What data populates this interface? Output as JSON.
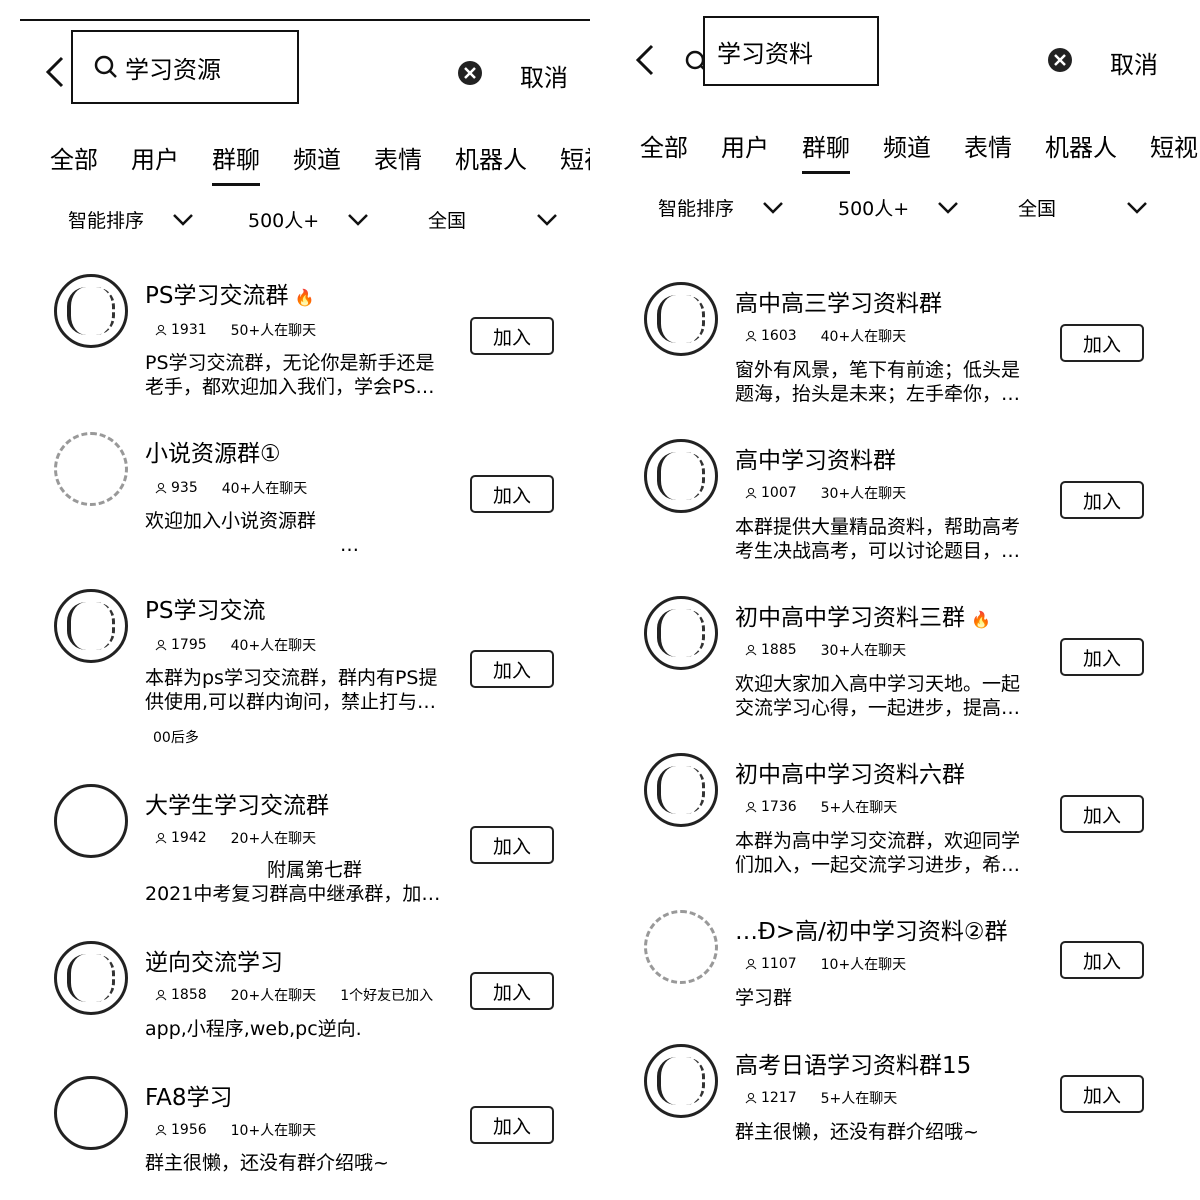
{
  "left": {
    "search": {
      "query": "学习资源"
    },
    "cancel_label": "取消",
    "tabs": [
      {
        "label": "全部"
      },
      {
        "label": "用户"
      },
      {
        "label": "群聊",
        "active": true
      },
      {
        "label": "频道"
      },
      {
        "label": "表情"
      },
      {
        "label": "机器人"
      },
      {
        "label": "短视"
      }
    ],
    "filters": [
      {
        "label": "智能排序"
      },
      {
        "label": "500人+"
      },
      {
        "label": "全国"
      }
    ],
    "groups": [
      {
        "name": "PS学习交流群",
        "hot": true,
        "members": "1931",
        "online": "50+人在聊天",
        "desc": [
          "PS学习交流群，无论你是新手还是",
          "老手，都欢迎加入我们，学会PS…"
        ],
        "join": "加入"
      },
      {
        "name": "小说资源群①",
        "members": "935",
        "online": "40+人在聊天",
        "desc": [
          "欢迎加入小说资源群",
          "…"
        ],
        "join": "加入"
      },
      {
        "name": "PS学习交流",
        "members": "1795",
        "online": "40+人在聊天",
        "desc": [
          "本群为ps学习交流群，群内有PS提",
          "供使用,可以群内询问，禁止打与…"
        ],
        "tag": "00后多",
        "join": "加入"
      },
      {
        "name": "大学生学习交流群",
        "members": "1942",
        "online": "20+人在聊天",
        "desc": [
          "附属第七群",
          "2021中考复习群高中继承群，加…"
        ],
        "join": "加入"
      },
      {
        "name": "逆向交流学习",
        "members": "1858",
        "online": "20+人在聊天",
        "friends": "1个好友已加入",
        "desc": [
          "app,小程序,web,pc逆向."
        ],
        "join": "加入"
      },
      {
        "name": "FA8学习",
        "members": "1956",
        "online": "10+人在聊天",
        "desc": [
          "群主很懒，还没有群介绍哦~"
        ],
        "join": "加入"
      }
    ]
  },
  "right": {
    "search": {
      "query": "学习资料"
    },
    "cancel_label": "取消",
    "tabs": [
      {
        "label": "全部"
      },
      {
        "label": "用户"
      },
      {
        "label": "群聊",
        "active": true
      },
      {
        "label": "频道"
      },
      {
        "label": "表情"
      },
      {
        "label": "机器人"
      },
      {
        "label": "短视"
      }
    ],
    "filters": [
      {
        "label": "智能排序"
      },
      {
        "label": "500人+"
      },
      {
        "label": "全国"
      }
    ],
    "groups": [
      {
        "name": "高中高三学习资料群",
        "members": "1603",
        "online": "40+人在聊天",
        "desc": [
          "窗外有风景，笔下有前途；低头是",
          "题海，抬头是未来；左手牵你，…"
        ],
        "join": "加入"
      },
      {
        "name": "高中学习资料群",
        "members": "1007",
        "online": "30+人在聊天",
        "desc": [
          "本群提供大量精品资料，帮助高考",
          "考生决战高考，可以讨论题目，…"
        ],
        "join": "加入"
      },
      {
        "name": "初中高中学习资料三群",
        "hot": true,
        "members": "1885",
        "online": "30+人在聊天",
        "desc": [
          "欢迎大家加入高中学习天地。一起",
          "交流学习心得，一起进步，提高…"
        ],
        "join": "加入"
      },
      {
        "name": "初中高中学习资料六群",
        "members": "1736",
        "online": "5+人在聊天",
        "desc": [
          "本群为高中学习交流群，欢迎同学",
          "们加入，一起交流学习进步，希…"
        ],
        "join": "加入"
      },
      {
        "name": "…Ð>高/初中学习资料②群",
        "members": "1107",
        "online": "10+人在聊天",
        "desc": [
          "学习群"
        ],
        "join": "加入"
      },
      {
        "name": "高考日语学习资料群15",
        "members": "1217",
        "online": "5+人在聊天",
        "desc": [
          "群主很懒，还没有群介绍哦~"
        ],
        "join": "加入"
      }
    ]
  }
}
